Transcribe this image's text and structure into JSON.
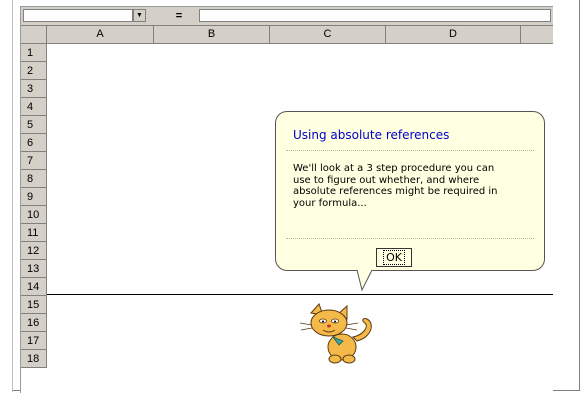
{
  "formula_bar": {
    "name_box_value": "",
    "dropdown_glyph": "▼",
    "equals_label": "=",
    "formula_value": ""
  },
  "columns": [
    "A",
    "B",
    "C",
    "D"
  ],
  "rows": [
    "1",
    "2",
    "3",
    "4",
    "5",
    "6",
    "7",
    "8",
    "9",
    "10",
    "11",
    "12",
    "13",
    "14",
    "15",
    "16",
    "17",
    "18"
  ],
  "assistant_balloon": {
    "title": "Using absolute references",
    "body": "We'll look at a 3 step procedure you can use to figure out whether, and where absolute references might be required in your formula...",
    "ok_label": "OK"
  },
  "assistant_character": "cat-icon"
}
